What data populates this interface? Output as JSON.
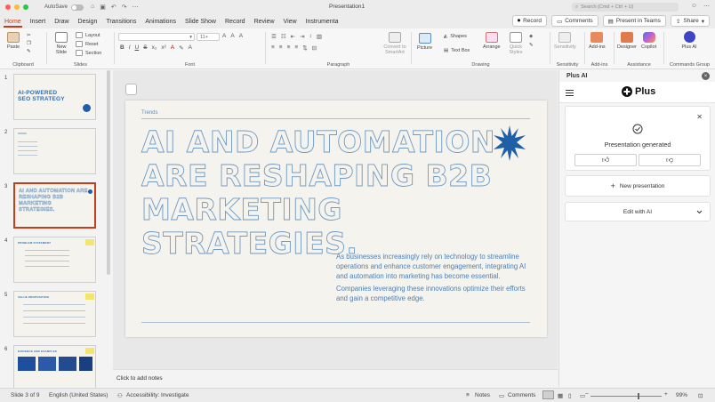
{
  "titlebar": {
    "autosave": "AutoSave",
    "doc_title": "Presentation1",
    "search_placeholder": "Search (Cmd + Ctrl + U)"
  },
  "tabs": [
    "Home",
    "Insert",
    "Draw",
    "Design",
    "Transitions",
    "Animations",
    "Slide Show",
    "Record",
    "Review",
    "View",
    "Instrumenta"
  ],
  "tab_buttons": {
    "record": "Record",
    "comments": "Comments",
    "present": "Present in Teams",
    "share": "Share"
  },
  "ribbon": {
    "groups": {
      "clipboard": "Clipboard",
      "slides": "Slides",
      "font": "Font",
      "paragraph": "Paragraph",
      "drawing": "Drawing",
      "sensitivity": "Sensitivity",
      "addins": "Add-ins",
      "assistance": "Assistance",
      "commands": "Commands Group"
    },
    "paste": "Paste",
    "new_slide": "New Slide",
    "layout": "Layout",
    "reset": "Reset",
    "section": "Section",
    "font_size": "11+",
    "convert": "Convert to SmartArt",
    "picture": "Picture",
    "shapes": "Shapes",
    "text_box": "Text Box",
    "arrange": "Arrange",
    "quick_styles": "Quick Styles",
    "sensitivity_btn": "Sensitivity",
    "addins_btn": "Add-ins",
    "designer": "Designer",
    "copilot": "Copilot",
    "plus_ai": "Plus AI"
  },
  "thumbnails": [
    {
      "num": "1",
      "title": "AI-POWERED SEO STRATEGY"
    },
    {
      "num": "2",
      "title": ""
    },
    {
      "num": "3",
      "title": "AI AND AUTOMATION ARE RESHAPING B2B MARKETING STRATEGIES."
    },
    {
      "num": "4",
      "title": "PROBLEM STATEMENT"
    },
    {
      "num": "5",
      "title": "VALUE PROPOSITION"
    },
    {
      "num": "6",
      "title": "EVIDENCE AND EXAMPLES"
    }
  ],
  "slide": {
    "kicker": "Trends",
    "headline": "AI AND AUTOMATION ARE RESHAPING B2B MARKETING STRATEGIES.",
    "body1": "As businesses increasingly rely on technology to streamline operations and enhance customer engagement, integrating AI and automation into marketing has become essential.",
    "body2": "Companies leveraging these innovations optimize their efforts and gain a competitive edge.",
    "accent_color": "#1f5fa8"
  },
  "notes_placeholder": "Click to add notes",
  "panel": {
    "title": "Plus AI",
    "logo": "Plus",
    "status": "Presentation generated",
    "new_presentation": "New presentation",
    "edit_with_ai": "Edit with AI"
  },
  "statusbar": {
    "slide": "Slide 3 of 9",
    "language": "English (United States)",
    "accessibility": "Accessibility: Investigate",
    "notes": "Notes",
    "comments": "Comments",
    "zoom": "99%"
  }
}
